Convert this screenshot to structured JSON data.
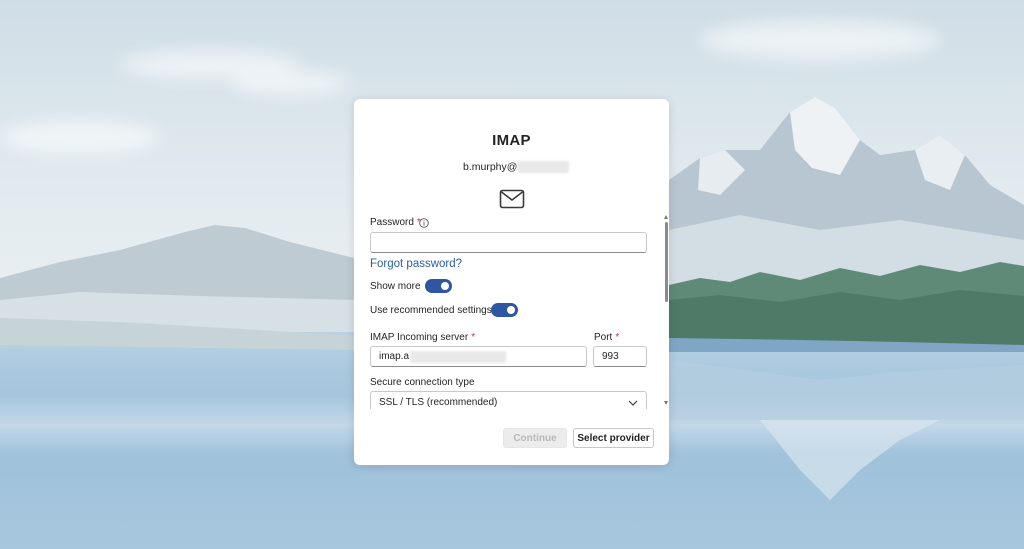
{
  "dialog": {
    "title": "IMAP",
    "account_email_prefix": "b.murphy@",
    "icon": "mail-envelope-icon"
  },
  "form": {
    "password": {
      "label": "Password",
      "required_mark": "*",
      "value": "",
      "info_icon": "info-circle-icon"
    },
    "forgot_password_link": "Forgot password?",
    "show_more": {
      "label": "Show more",
      "on": true
    },
    "use_recommended": {
      "label": "Use recommended settings",
      "on": true
    },
    "incoming_server": {
      "label": "IMAP Incoming server",
      "required_mark": "*",
      "value_prefix": "imap.a"
    },
    "port": {
      "label": "Port",
      "required_mark": "*",
      "value": "993"
    },
    "secure_connection": {
      "label": "Secure connection type",
      "selected": "SSL / TLS (recommended)",
      "icon": "chevron-down-icon"
    }
  },
  "buttons": {
    "continue": {
      "label": "Continue",
      "enabled": false
    },
    "select_provider": {
      "label": "Select provider"
    }
  },
  "colors": {
    "accent": "#2f56a0",
    "link": "#2b5f9e",
    "required": "#c4314b"
  }
}
